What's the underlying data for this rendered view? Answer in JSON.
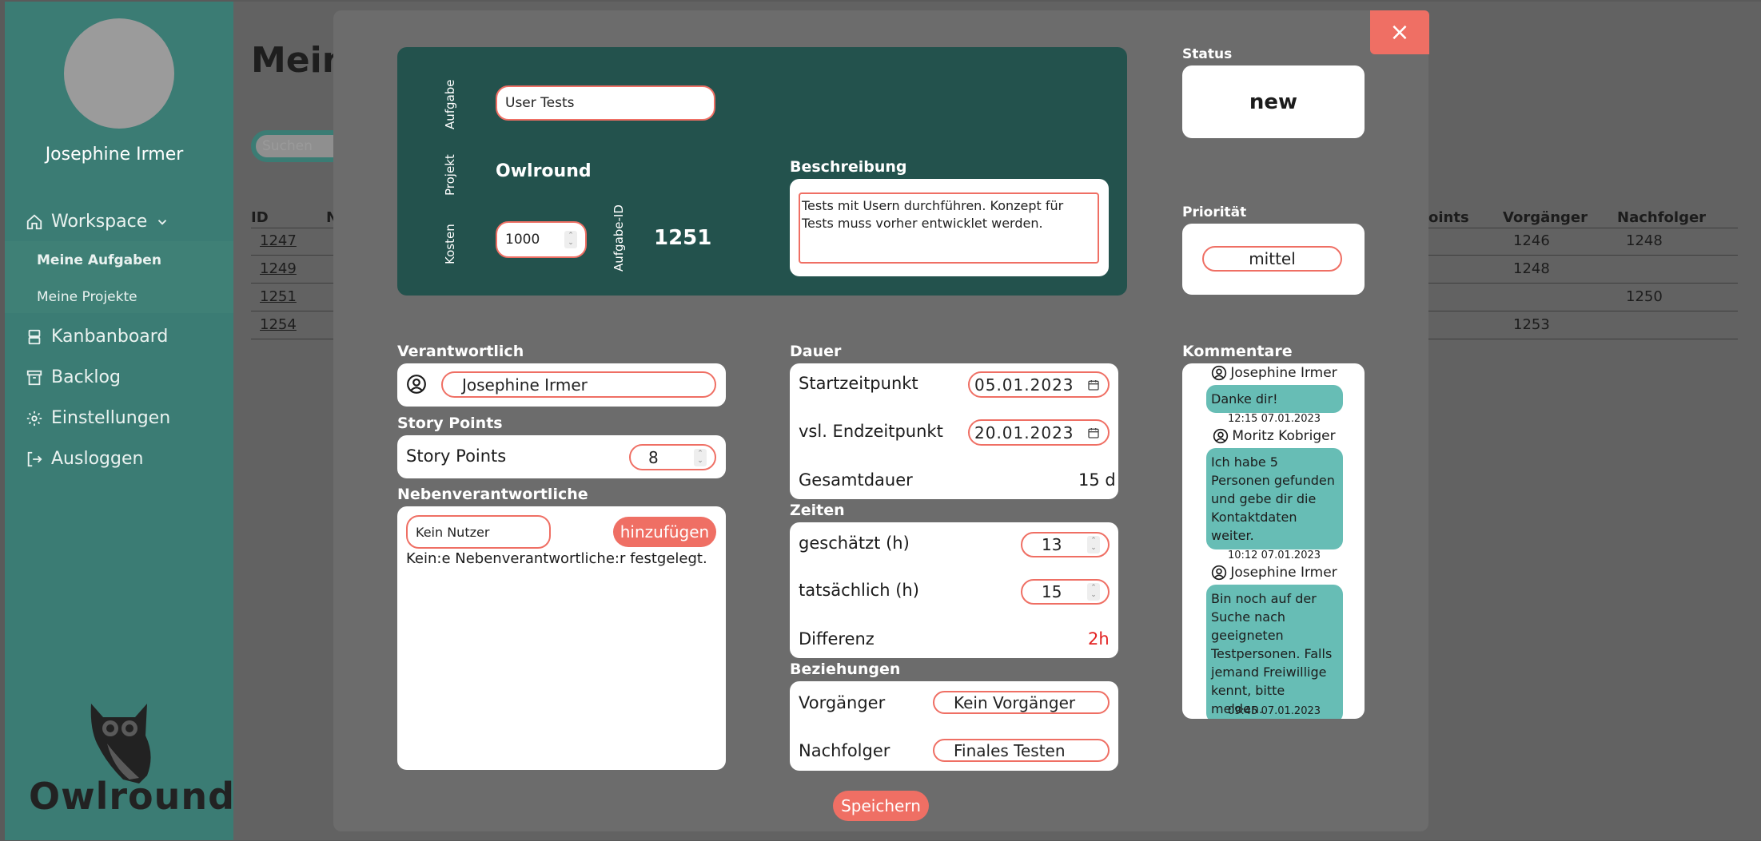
{
  "sidebar": {
    "user_name": "Josephine Irmer",
    "workspace_label": "Workspace",
    "sub_items": [
      "Meine Aufgaben",
      "Meine Projekte"
    ],
    "items": [
      "Kanbanboard",
      "Backlog",
      "Einstellungen",
      "Ausloggen"
    ],
    "logo_text": "Owlround"
  },
  "background": {
    "page_title": "Mein",
    "search_placeholder": "Suchen",
    "columns": [
      "ID",
      "N",
      "oints",
      "Vorgänger",
      "Nachfolger"
    ],
    "rows": [
      {
        "id": "1247",
        "vorg": "1246",
        "nach": "1248"
      },
      {
        "id": "1249",
        "vorg": "1248",
        "nach": ""
      },
      {
        "id": "1251",
        "vorg": "",
        "nach": "1250"
      },
      {
        "id": "1254",
        "vorg": "1253",
        "nach": ""
      }
    ]
  },
  "modal": {
    "close_label": "×",
    "top": {
      "aufgabe_label": "Aufgabe",
      "aufgabe_value": "User Tests",
      "projekt_label": "Projekt",
      "projekt_value": "Owlround",
      "kosten_label": "Kosten",
      "kosten_value": "1000",
      "aufgabe_id_label": "Aufgabe-ID",
      "aufgabe_id_value": "1251",
      "beschreibung_label": "Beschreibung",
      "beschreibung_value": "Tests mit Usern durchführen. Konzept für Tests muss vorher entwicklet werden."
    },
    "status_label": "Status",
    "status_value": "new",
    "prioritaet_label": "Priorität",
    "prioritaet_value": "mittel",
    "verantwortlich_label": "Verantwortlich",
    "verantwortlich_value": "Josephine Irmer",
    "story_points_section": "Story Points",
    "story_points_label": "Story Points",
    "story_points_value": "8",
    "neben_label": "Nebenverantwortliche",
    "neben_select": "Kein Nutzer",
    "neben_add": "hinzufügen",
    "neben_empty": "Kein:e Nebenverantwortliche:r festgelegt.",
    "dauer_label": "Dauer",
    "start_label": "Startzeitpunkt",
    "start_value": "05.01.2023",
    "end_label": "vsl. Endzeitpunkt",
    "end_value": "20.01.2023",
    "gesamt_label": "Gesamtdauer",
    "gesamt_value": "15 d",
    "zeiten_label": "Zeiten",
    "geschaetzt_label": "geschätzt (h)",
    "geschaetzt_value": "13",
    "tatsaechlich_label": "tatsächlich (h)",
    "tatsaechlich_value": "15",
    "differenz_label": "Differenz",
    "differenz_value": "2h",
    "beziehungen_label": "Beziehungen",
    "vorgaenger_label": "Vorgänger",
    "vorgaenger_value": "Kein Vorgänger",
    "nachfolger_label": "Nachfolger",
    "nachfolger_value": "Finales Testen",
    "kommentare_label": "Kommentare",
    "comments": [
      {
        "author": "Josephine Irmer",
        "text": "Danke dir!",
        "time": "12:15 07.01.2023"
      },
      {
        "author": "Moritz Kobriger",
        "text": "Ich habe 5 Personen gefunden und gebe dir die Kontaktdaten weiter.",
        "time": "10:12 07.01.2023"
      },
      {
        "author": "Josephine Irmer",
        "text": "Bin noch auf der Suche nach geeigneten Testpersonen. Falls jemand Freiwillige kennt, bitte melden.",
        "time": "09:45 07.01.2023"
      }
    ],
    "save_label": "Speichern"
  },
  "colors": {
    "sidebar": "#3b7c74",
    "accent": "#ef6f64",
    "dark_card": "#23524d",
    "bubble": "#67bdb5",
    "differenz": "#e32222"
  }
}
